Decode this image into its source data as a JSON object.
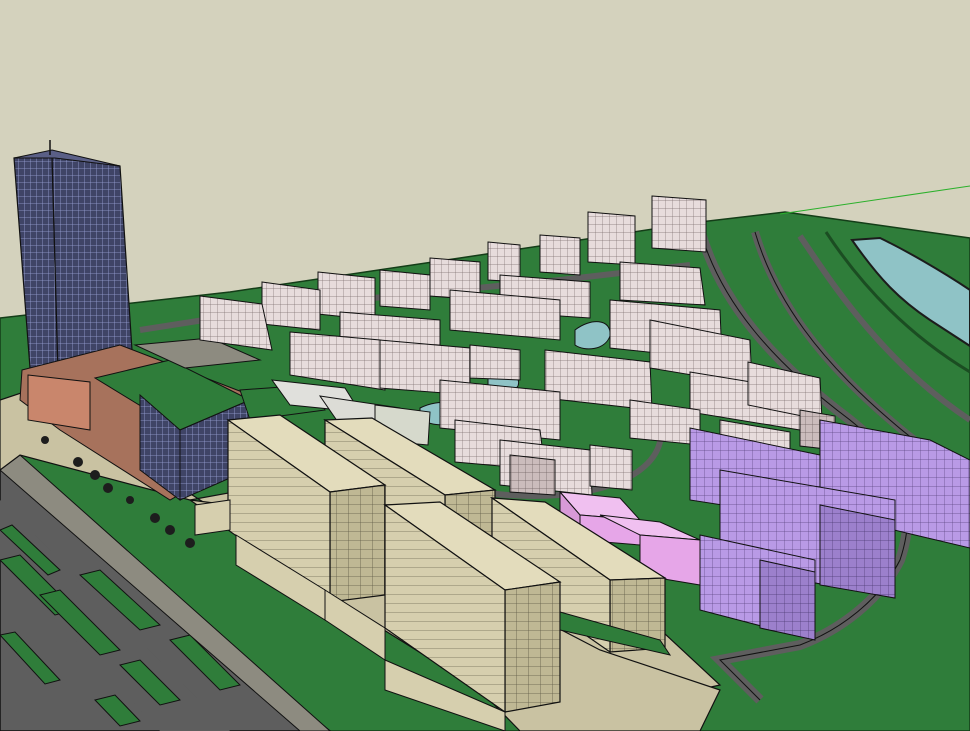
{
  "scene": {
    "colors": {
      "sky": "#d4d2bd",
      "grass": "#2f7d3a",
      "road": "#5e5e5e",
      "plaza": "#c9c2a2",
      "water": "#8fc3c6",
      "tower_glass": "#3f4466",
      "residential_pink": "#e7dcdc",
      "residential_purple": "#b99ae6",
      "magenta_block": "#e6a6e8",
      "office_tan": "#d6cfae"
    },
    "axis_line_color": "#2bb02b"
  }
}
